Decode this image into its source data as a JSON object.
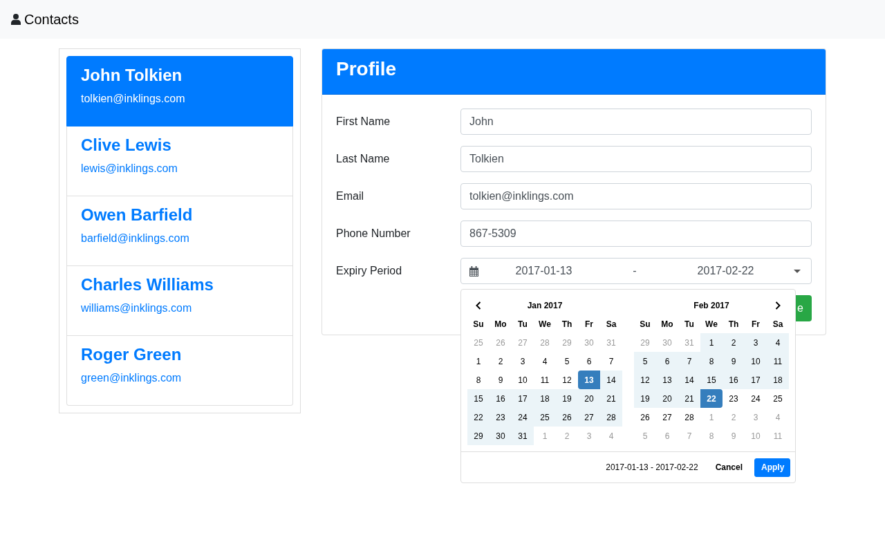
{
  "navbar": {
    "brand": "Contacts"
  },
  "contacts": [
    {
      "name": "John Tolkien",
      "email": "tolkien@inklings.com",
      "selected": true
    },
    {
      "name": "Clive Lewis",
      "email": "lewis@inklings.com",
      "selected": false
    },
    {
      "name": "Owen Barfield",
      "email": "barfield@inklings.com",
      "selected": false
    },
    {
      "name": "Charles Williams",
      "email": "williams@inklings.com",
      "selected": false
    },
    {
      "name": "Roger Green",
      "email": "green@inklings.com",
      "selected": false
    }
  ],
  "profile": {
    "title": "Profile",
    "fields": [
      {
        "label": "First Name",
        "value": "John"
      },
      {
        "label": "Last Name",
        "value": "Tolkien"
      },
      {
        "label": "Email",
        "value": "tolkien@inklings.com"
      },
      {
        "label": "Phone Number",
        "value": "867-5309"
      }
    ],
    "expiry": {
      "label": "Expiry Period",
      "start": "2017-01-13",
      "separator": "-",
      "end": "2017-02-22"
    },
    "action_button": "e"
  },
  "date_picker": {
    "months": [
      {
        "title": "Jan 2017",
        "has_prev": true,
        "has_next": false,
        "weekdays": [
          "Su",
          "Mo",
          "Tu",
          "We",
          "Th",
          "Fr",
          "Sa"
        ],
        "weeks": [
          [
            {
              "day": "25",
              "off": true,
              "in_range": false,
              "selected": false
            },
            {
              "day": "26",
              "off": true,
              "in_range": false,
              "selected": false
            },
            {
              "day": "27",
              "off": true,
              "in_range": false,
              "selected": false
            },
            {
              "day": "28",
              "off": true,
              "in_range": false,
              "selected": false
            },
            {
              "day": "29",
              "off": true,
              "in_range": false,
              "selected": false
            },
            {
              "day": "30",
              "off": true,
              "in_range": false,
              "selected": false
            },
            {
              "day": "31",
              "off": true,
              "in_range": false,
              "selected": false
            }
          ],
          [
            {
              "day": "1",
              "off": false,
              "in_range": false,
              "selected": false
            },
            {
              "day": "2",
              "off": false,
              "in_range": false,
              "selected": false
            },
            {
              "day": "3",
              "off": false,
              "in_range": false,
              "selected": false
            },
            {
              "day": "4",
              "off": false,
              "in_range": false,
              "selected": false
            },
            {
              "day": "5",
              "off": false,
              "in_range": false,
              "selected": false
            },
            {
              "day": "6",
              "off": false,
              "in_range": false,
              "selected": false
            },
            {
              "day": "7",
              "off": false,
              "in_range": false,
              "selected": false
            }
          ],
          [
            {
              "day": "8",
              "off": false,
              "in_range": false,
              "selected": false
            },
            {
              "day": "9",
              "off": false,
              "in_range": false,
              "selected": false
            },
            {
              "day": "10",
              "off": false,
              "in_range": false,
              "selected": false
            },
            {
              "day": "11",
              "off": false,
              "in_range": false,
              "selected": false
            },
            {
              "day": "12",
              "off": false,
              "in_range": false,
              "selected": false
            },
            {
              "day": "13",
              "off": false,
              "in_range": false,
              "selected": true
            },
            {
              "day": "14",
              "off": false,
              "in_range": true,
              "selected": false
            }
          ],
          [
            {
              "day": "15",
              "off": false,
              "in_range": true,
              "selected": false
            },
            {
              "day": "16",
              "off": false,
              "in_range": true,
              "selected": false
            },
            {
              "day": "17",
              "off": false,
              "in_range": true,
              "selected": false
            },
            {
              "day": "18",
              "off": false,
              "in_range": true,
              "selected": false
            },
            {
              "day": "19",
              "off": false,
              "in_range": true,
              "selected": false
            },
            {
              "day": "20",
              "off": false,
              "in_range": true,
              "selected": false
            },
            {
              "day": "21",
              "off": false,
              "in_range": true,
              "selected": false
            }
          ],
          [
            {
              "day": "22",
              "off": false,
              "in_range": true,
              "selected": false
            },
            {
              "day": "23",
              "off": false,
              "in_range": true,
              "selected": false
            },
            {
              "day": "24",
              "off": false,
              "in_range": true,
              "selected": false
            },
            {
              "day": "25",
              "off": false,
              "in_range": true,
              "selected": false
            },
            {
              "day": "26",
              "off": false,
              "in_range": true,
              "selected": false
            },
            {
              "day": "27",
              "off": false,
              "in_range": true,
              "selected": false
            },
            {
              "day": "28",
              "off": false,
              "in_range": true,
              "selected": false
            }
          ],
          [
            {
              "day": "29",
              "off": false,
              "in_range": true,
              "selected": false
            },
            {
              "day": "30",
              "off": false,
              "in_range": true,
              "selected": false
            },
            {
              "day": "31",
              "off": false,
              "in_range": true,
              "selected": false
            },
            {
              "day": "1",
              "off": true,
              "in_range": false,
              "selected": false
            },
            {
              "day": "2",
              "off": true,
              "in_range": false,
              "selected": false
            },
            {
              "day": "3",
              "off": true,
              "in_range": false,
              "selected": false
            },
            {
              "day": "4",
              "off": true,
              "in_range": false,
              "selected": false
            }
          ]
        ]
      },
      {
        "title": "Feb 2017",
        "has_prev": false,
        "has_next": true,
        "weekdays": [
          "Su",
          "Mo",
          "Tu",
          "We",
          "Th",
          "Fr",
          "Sa"
        ],
        "weeks": [
          [
            {
              "day": "29",
              "off": true,
              "in_range": false,
              "selected": false
            },
            {
              "day": "30",
              "off": true,
              "in_range": false,
              "selected": false
            },
            {
              "day": "31",
              "off": true,
              "in_range": false,
              "selected": false
            },
            {
              "day": "1",
              "off": false,
              "in_range": true,
              "selected": false
            },
            {
              "day": "2",
              "off": false,
              "in_range": true,
              "selected": false
            },
            {
              "day": "3",
              "off": false,
              "in_range": true,
              "selected": false
            },
            {
              "day": "4",
              "off": false,
              "in_range": true,
              "selected": false
            }
          ],
          [
            {
              "day": "5",
              "off": false,
              "in_range": true,
              "selected": false
            },
            {
              "day": "6",
              "off": false,
              "in_range": true,
              "selected": false
            },
            {
              "day": "7",
              "off": false,
              "in_range": true,
              "selected": false
            },
            {
              "day": "8",
              "off": false,
              "in_range": true,
              "selected": false
            },
            {
              "day": "9",
              "off": false,
              "in_range": true,
              "selected": false
            },
            {
              "day": "10",
              "off": false,
              "in_range": true,
              "selected": false
            },
            {
              "day": "11",
              "off": false,
              "in_range": true,
              "selected": false
            }
          ],
          [
            {
              "day": "12",
              "off": false,
              "in_range": true,
              "selected": false
            },
            {
              "day": "13",
              "off": false,
              "in_range": true,
              "selected": false
            },
            {
              "day": "14",
              "off": false,
              "in_range": true,
              "selected": false
            },
            {
              "day": "15",
              "off": false,
              "in_range": true,
              "selected": false
            },
            {
              "day": "16",
              "off": false,
              "in_range": true,
              "selected": false
            },
            {
              "day": "17",
              "off": false,
              "in_range": true,
              "selected": false
            },
            {
              "day": "18",
              "off": false,
              "in_range": true,
              "selected": false
            }
          ],
          [
            {
              "day": "19",
              "off": false,
              "in_range": true,
              "selected": false
            },
            {
              "day": "20",
              "off": false,
              "in_range": true,
              "selected": false
            },
            {
              "day": "21",
              "off": false,
              "in_range": true,
              "selected": false
            },
            {
              "day": "22",
              "off": false,
              "in_range": false,
              "selected": true
            },
            {
              "day": "23",
              "off": false,
              "in_range": false,
              "selected": false
            },
            {
              "day": "24",
              "off": false,
              "in_range": false,
              "selected": false
            },
            {
              "day": "25",
              "off": false,
              "in_range": false,
              "selected": false
            }
          ],
          [
            {
              "day": "26",
              "off": false,
              "in_range": false,
              "selected": false
            },
            {
              "day": "27",
              "off": false,
              "in_range": false,
              "selected": false
            },
            {
              "day": "28",
              "off": false,
              "in_range": false,
              "selected": false
            },
            {
              "day": "1",
              "off": true,
              "in_range": false,
              "selected": false
            },
            {
              "day": "2",
              "off": true,
              "in_range": false,
              "selected": false
            },
            {
              "day": "3",
              "off": true,
              "in_range": false,
              "selected": false
            },
            {
              "day": "4",
              "off": true,
              "in_range": false,
              "selected": false
            }
          ],
          [
            {
              "day": "5",
              "off": true,
              "in_range": false,
              "selected": false
            },
            {
              "day": "6",
              "off": true,
              "in_range": false,
              "selected": false
            },
            {
              "day": "7",
              "off": true,
              "in_range": false,
              "selected": false
            },
            {
              "day": "8",
              "off": true,
              "in_range": false,
              "selected": false
            },
            {
              "day": "9",
              "off": true,
              "in_range": false,
              "selected": false
            },
            {
              "day": "10",
              "off": true,
              "in_range": false,
              "selected": false
            },
            {
              "day": "11",
              "off": true,
              "in_range": false,
              "selected": false
            }
          ]
        ]
      }
    ],
    "selected_range": "2017-01-13 - 2017-02-22",
    "cancel": "Cancel",
    "apply": "Apply"
  }
}
